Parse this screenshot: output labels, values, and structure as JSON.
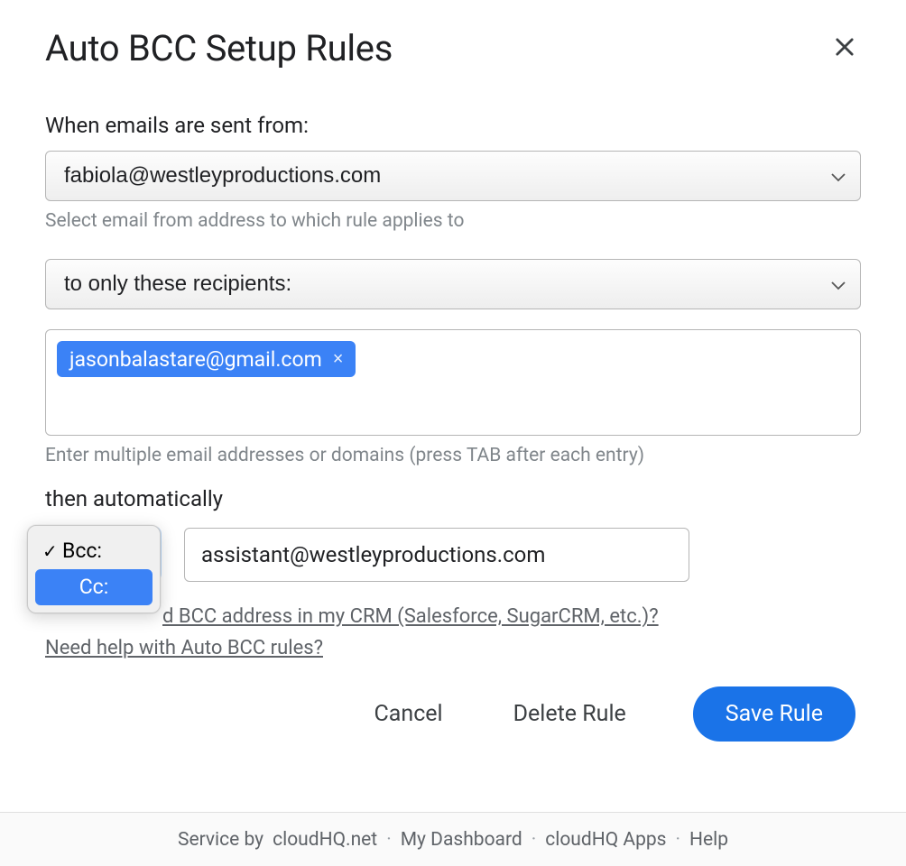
{
  "title": "Auto BCC Setup Rules",
  "from_label": "When emails are sent from:",
  "from_value": "fabiola@westleyproductions.com",
  "from_hint": "Select email from address to which rule applies to",
  "recipients_scope": "to only these recipients:",
  "recipients_chip": "jasonbalastare@gmail.com",
  "recipients_hint": "Enter multiple email addresses or domains (press TAB after each entry)",
  "then_label": "then automatically",
  "bcc_cc_options": {
    "selected": "Bcc:",
    "highlighted": "Cc:"
  },
  "target_email": "assistant@westleyproductions.com",
  "help_link_crm": "d BCC address in my CRM (Salesforce, SugarCRM, etc.)?",
  "help_link_rules": "Need help with Auto BCC rules?",
  "buttons": {
    "cancel": "Cancel",
    "delete": "Delete Rule",
    "save": "Save Rule"
  },
  "footer": {
    "service_prefix": "Service by ",
    "service_name": "cloudHQ.net",
    "dashboard": "My Dashboard",
    "apps": "cloudHQ Apps",
    "help": "Help"
  }
}
